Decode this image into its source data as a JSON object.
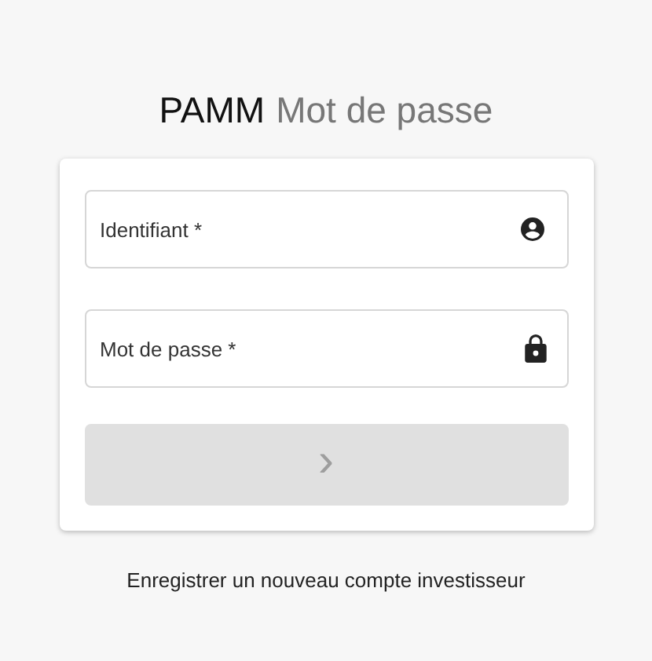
{
  "header": {
    "brand": "PAMM",
    "title": "Mot de passe"
  },
  "fields": [
    {
      "kind": "user",
      "placeholder": "Identifiant *"
    },
    {
      "kind": "password",
      "placeholder": "Mot de passe *"
    }
  ],
  "submit": {
    "icon": "›",
    "disabled": true
  },
  "link": "Enregistrer un nouveau compte investisseur"
}
